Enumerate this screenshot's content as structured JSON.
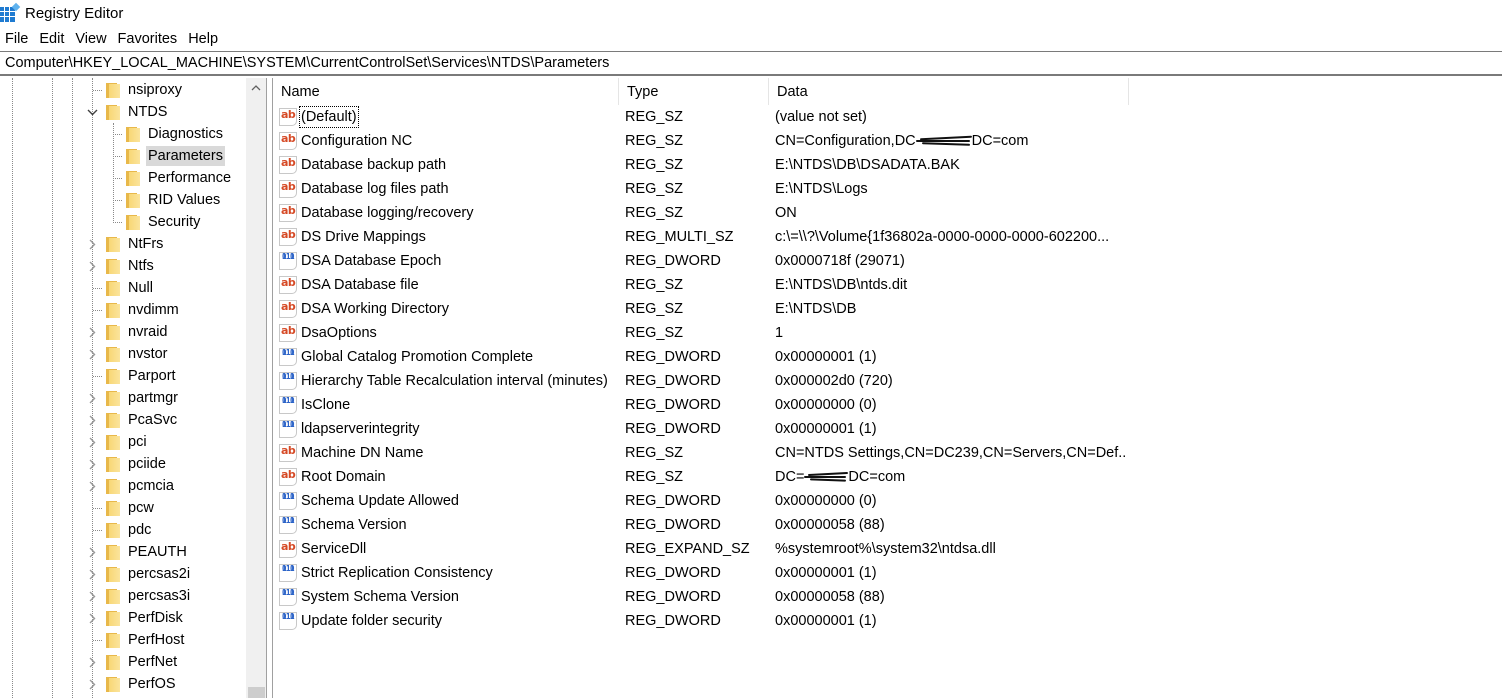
{
  "window": {
    "title": "Registry Editor",
    "icon": "registry-editor-icon"
  },
  "menu": [
    "File",
    "Edit",
    "View",
    "Favorites",
    "Help"
  ],
  "address": "Computer\\HKEY_LOCAL_MACHINE\\SYSTEM\\CurrentControlSet\\Services\\NTDS\\Parameters",
  "tree": {
    "items": [
      {
        "label": "nsiproxy",
        "depth": 0,
        "expander": "none"
      },
      {
        "label": "NTDS",
        "depth": 0,
        "expander": "expanded"
      },
      {
        "label": "Diagnostics",
        "depth": 1,
        "expander": "none"
      },
      {
        "label": "Parameters",
        "depth": 1,
        "expander": "none",
        "selected": true
      },
      {
        "label": "Performance",
        "depth": 1,
        "expander": "none"
      },
      {
        "label": "RID Values",
        "depth": 1,
        "expander": "none"
      },
      {
        "label": "Security",
        "depth": 1,
        "expander": "none"
      },
      {
        "label": "NtFrs",
        "depth": 0,
        "expander": "collapsed"
      },
      {
        "label": "Ntfs",
        "depth": 0,
        "expander": "collapsed"
      },
      {
        "label": "Null",
        "depth": 0,
        "expander": "none"
      },
      {
        "label": "nvdimm",
        "depth": 0,
        "expander": "none"
      },
      {
        "label": "nvraid",
        "depth": 0,
        "expander": "collapsed"
      },
      {
        "label": "nvstor",
        "depth": 0,
        "expander": "collapsed"
      },
      {
        "label": "Parport",
        "depth": 0,
        "expander": "none"
      },
      {
        "label": "partmgr",
        "depth": 0,
        "expander": "collapsed"
      },
      {
        "label": "PcaSvc",
        "depth": 0,
        "expander": "collapsed"
      },
      {
        "label": "pci",
        "depth": 0,
        "expander": "collapsed"
      },
      {
        "label": "pciide",
        "depth": 0,
        "expander": "collapsed"
      },
      {
        "label": "pcmcia",
        "depth": 0,
        "expander": "collapsed"
      },
      {
        "label": "pcw",
        "depth": 0,
        "expander": "none"
      },
      {
        "label": "pdc",
        "depth": 0,
        "expander": "none"
      },
      {
        "label": "PEAUTH",
        "depth": 0,
        "expander": "collapsed"
      },
      {
        "label": "percsas2i",
        "depth": 0,
        "expander": "collapsed"
      },
      {
        "label": "percsas3i",
        "depth": 0,
        "expander": "collapsed"
      },
      {
        "label": "PerfDisk",
        "depth": 0,
        "expander": "collapsed"
      },
      {
        "label": "PerfHost",
        "depth": 0,
        "expander": "none"
      },
      {
        "label": "PerfNet",
        "depth": 0,
        "expander": "collapsed"
      },
      {
        "label": "PerfOS",
        "depth": 0,
        "expander": "collapsed"
      }
    ]
  },
  "list": {
    "columns": {
      "name": "Name",
      "type": "Type",
      "data": "Data"
    },
    "rows": [
      {
        "icon": "string",
        "name": "(Default)",
        "type": "REG_SZ",
        "data": "(value not set)",
        "focused": true
      },
      {
        "icon": "string",
        "name": "Configuration NC",
        "type": "REG_SZ",
        "data": "CN=Configuration,DC",
        "data_redacted": true,
        "data_suffix": "DC=com"
      },
      {
        "icon": "string",
        "name": "Database backup path",
        "type": "REG_SZ",
        "data": "E:\\NTDS\\DB\\DSADATA.BAK"
      },
      {
        "icon": "string",
        "name": "Database log files path",
        "type": "REG_SZ",
        "data": "E:\\NTDS\\Logs"
      },
      {
        "icon": "string",
        "name": "Database logging/recovery",
        "type": "REG_SZ",
        "data": "ON"
      },
      {
        "icon": "string",
        "name": "DS Drive Mappings",
        "type": "REG_MULTI_SZ",
        "data": "c:\\=\\\\?\\Volume{1f36802a-0000-0000-0000-602200..."
      },
      {
        "icon": "binary",
        "name": "DSA Database Epoch",
        "type": "REG_DWORD",
        "data": "0x0000718f (29071)"
      },
      {
        "icon": "string",
        "name": "DSA Database file",
        "type": "REG_SZ",
        "data": "E:\\NTDS\\DB\\ntds.dit"
      },
      {
        "icon": "string",
        "name": "DSA Working Directory",
        "type": "REG_SZ",
        "data": "E:\\NTDS\\DB"
      },
      {
        "icon": "string",
        "name": "DsaOptions",
        "type": "REG_SZ",
        "data": "1"
      },
      {
        "icon": "binary",
        "name": "Global Catalog Promotion Complete",
        "type": "REG_DWORD",
        "data": "0x00000001 (1)"
      },
      {
        "icon": "binary",
        "name": "Hierarchy Table Recalculation interval (minutes)",
        "type": "REG_DWORD",
        "data": "0x000002d0 (720)"
      },
      {
        "icon": "binary",
        "name": "IsClone",
        "type": "REG_DWORD",
        "data": "0x00000000 (0)"
      },
      {
        "icon": "binary",
        "name": "ldapserverintegrity",
        "type": "REG_DWORD",
        "data": "0x00000001 (1)"
      },
      {
        "icon": "string",
        "name": "Machine DN Name",
        "type": "REG_SZ",
        "data": "CN=NTDS Settings,CN=DC239,CN=Servers,CN=Def..."
      },
      {
        "icon": "string",
        "name": "Root Domain",
        "type": "REG_SZ",
        "data": "DC=",
        "data_redacted": true,
        "data_suffix": "DC=com"
      },
      {
        "icon": "binary",
        "name": "Schema Update Allowed",
        "type": "REG_DWORD",
        "data": "0x00000000 (0)"
      },
      {
        "icon": "binary",
        "name": "Schema Version",
        "type": "REG_DWORD",
        "data": "0x00000058 (88)"
      },
      {
        "icon": "string",
        "name": "ServiceDll",
        "type": "REG_EXPAND_SZ",
        "data": "%systemroot%\\system32\\ntdsa.dll"
      },
      {
        "icon": "binary",
        "name": "Strict Replication Consistency",
        "type": "REG_DWORD",
        "data": "0x00000001 (1)"
      },
      {
        "icon": "binary",
        "name": "System Schema Version",
        "type": "REG_DWORD",
        "data": "0x00000058 (88)"
      },
      {
        "icon": "binary",
        "name": "Update folder security",
        "type": "REG_DWORD",
        "data": "0x00000001 (1)"
      }
    ]
  },
  "icons": {
    "string_glyph": "ab",
    "binary_glyph_top": "011",
    "binary_glyph_bottom": "110"
  }
}
